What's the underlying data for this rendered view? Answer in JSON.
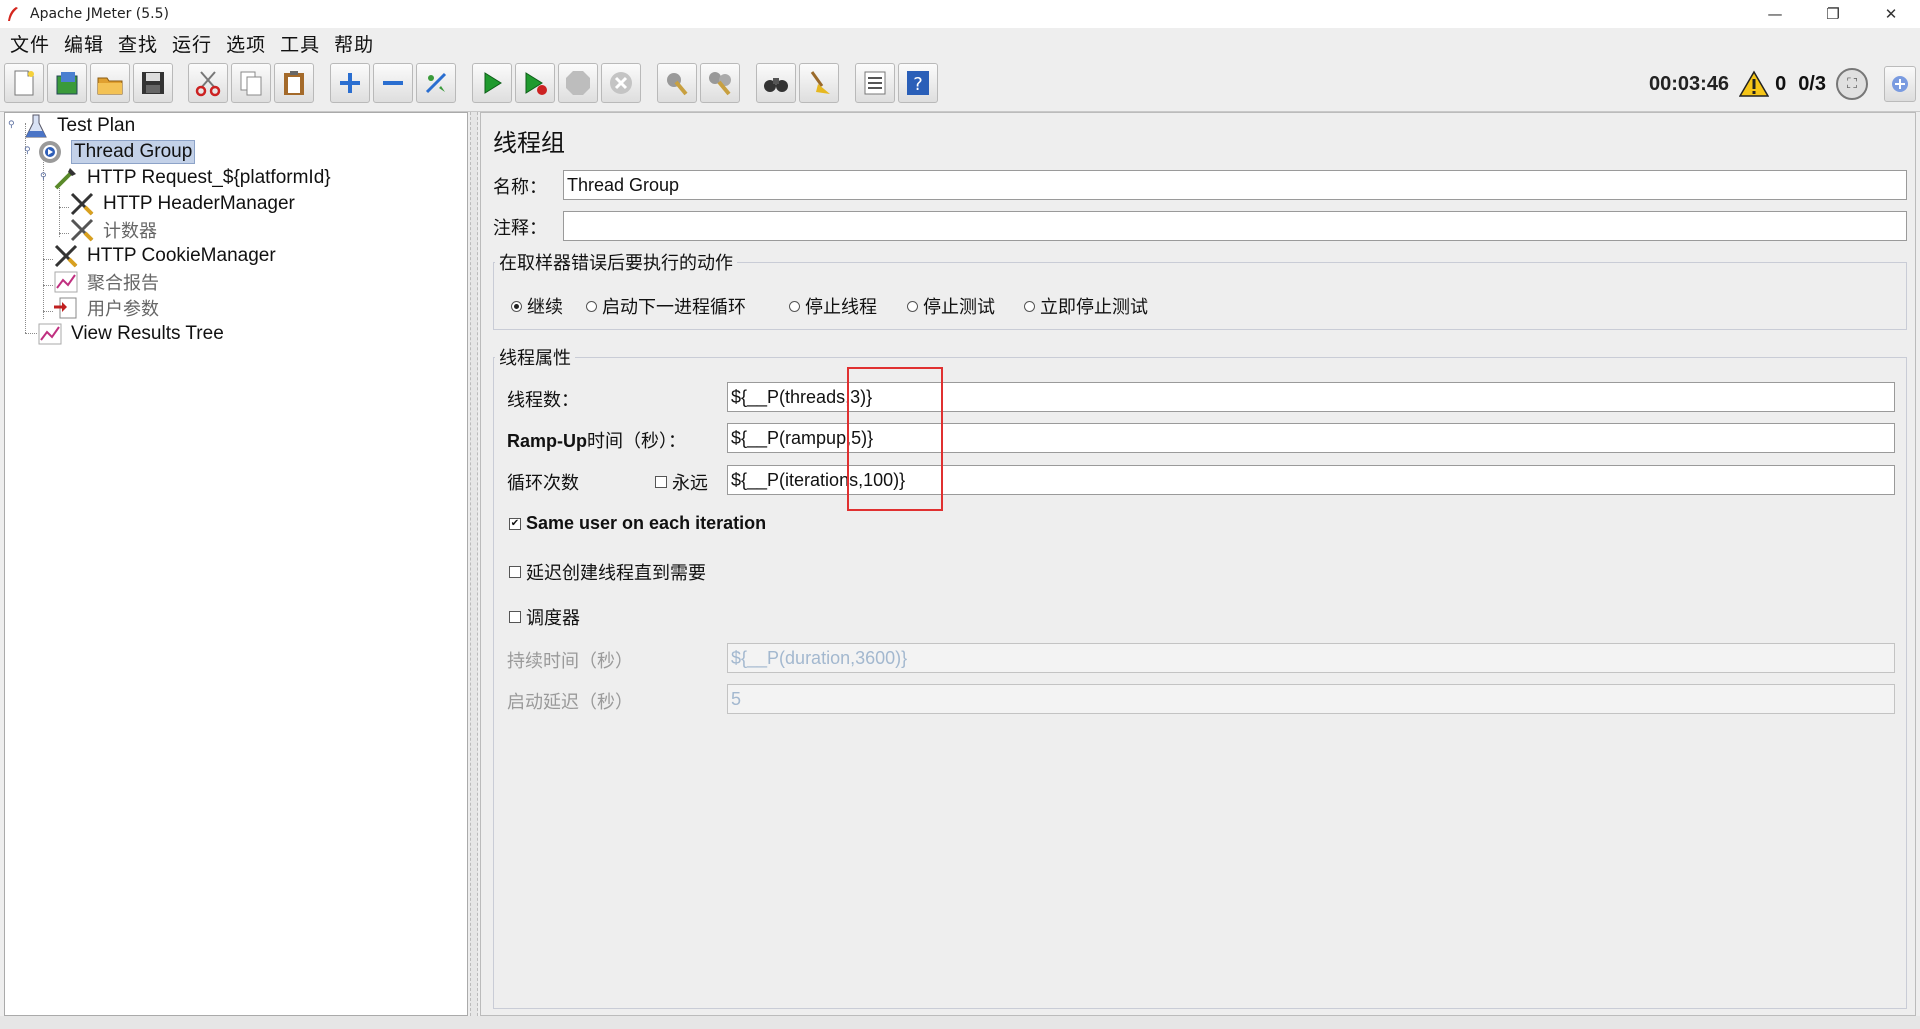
{
  "window": {
    "title": "Apache JMeter (5.5)",
    "minimize": "—",
    "restore": "❐",
    "close": "✕"
  },
  "menu": [
    "文件",
    "编辑",
    "查找",
    "运行",
    "选项",
    "工具",
    "帮助"
  ],
  "toolbar": {
    "buttons": [
      "new-icon",
      "templates-icon",
      "open-icon",
      "save-icon",
      "cut-icon",
      "copy-icon",
      "paste-icon",
      "expand-icon",
      "collapse-icon",
      "toggle-icon",
      "start-icon",
      "start-no-pause-icon",
      "stop-icon",
      "shutdown-icon",
      "clear-icon",
      "clear-all-icon",
      "search-icon",
      "reset-search-icon",
      "function-helper-icon",
      "help-icon"
    ],
    "elapsed_time": "00:03:46",
    "warning_count": "0",
    "active_threads": "0/3"
  },
  "tree": {
    "nodes": [
      {
        "label": "Test Plan",
        "icon": "test-plan-icon"
      },
      {
        "label": "Thread Group",
        "icon": "thread-group-icon",
        "selected": true
      },
      {
        "label": "HTTP Request_${platformId}",
        "icon": "sampler-icon"
      },
      {
        "label": "HTTP HeaderManager",
        "icon": "config-icon"
      },
      {
        "label": "计数器",
        "icon": "config-icon"
      },
      {
        "label": "HTTP CookieManager",
        "icon": "config-icon"
      },
      {
        "label": "聚合报告",
        "icon": "listener-icon"
      },
      {
        "label": "用户参数",
        "icon": "preprocessor-icon"
      },
      {
        "label": "View Results Tree",
        "icon": "listener-icon"
      }
    ]
  },
  "thread_group": {
    "title": "线程组",
    "name_label": "名称：",
    "name_value": "Thread Group",
    "comment_label": "注释：",
    "comment_value": "",
    "error_section": {
      "title": "在取样器错误后要执行的动作",
      "options": [
        "继续",
        "启动下一进程循环",
        "停止线程",
        "停止测试",
        "立即停止测试"
      ],
      "selected": "继续"
    },
    "properties": {
      "title": "线程属性",
      "threads_label": "线程数：",
      "threads_value": "${__P(threads,3)}",
      "rampup_label_bold": "Ramp-Up",
      "rampup_label_rest": "时间（秒）：",
      "rampup_value": "${__P(rampup,5)}",
      "loops_label": "循环次数",
      "forever_label": "永远",
      "forever_checked": false,
      "loops_value": "${__P(iterations,100)}",
      "same_user_label": "Same user on each iteration",
      "same_user_checked": true,
      "delay_label": "延迟创建线程直到需要",
      "delay_checked": false,
      "scheduler_label": "调度器",
      "scheduler_checked": false,
      "duration_label": "持续时间（秒）",
      "duration_value": "${__P(duration,3600)}",
      "startup_label": "启动延迟（秒）",
      "startup_value": "5"
    }
  }
}
